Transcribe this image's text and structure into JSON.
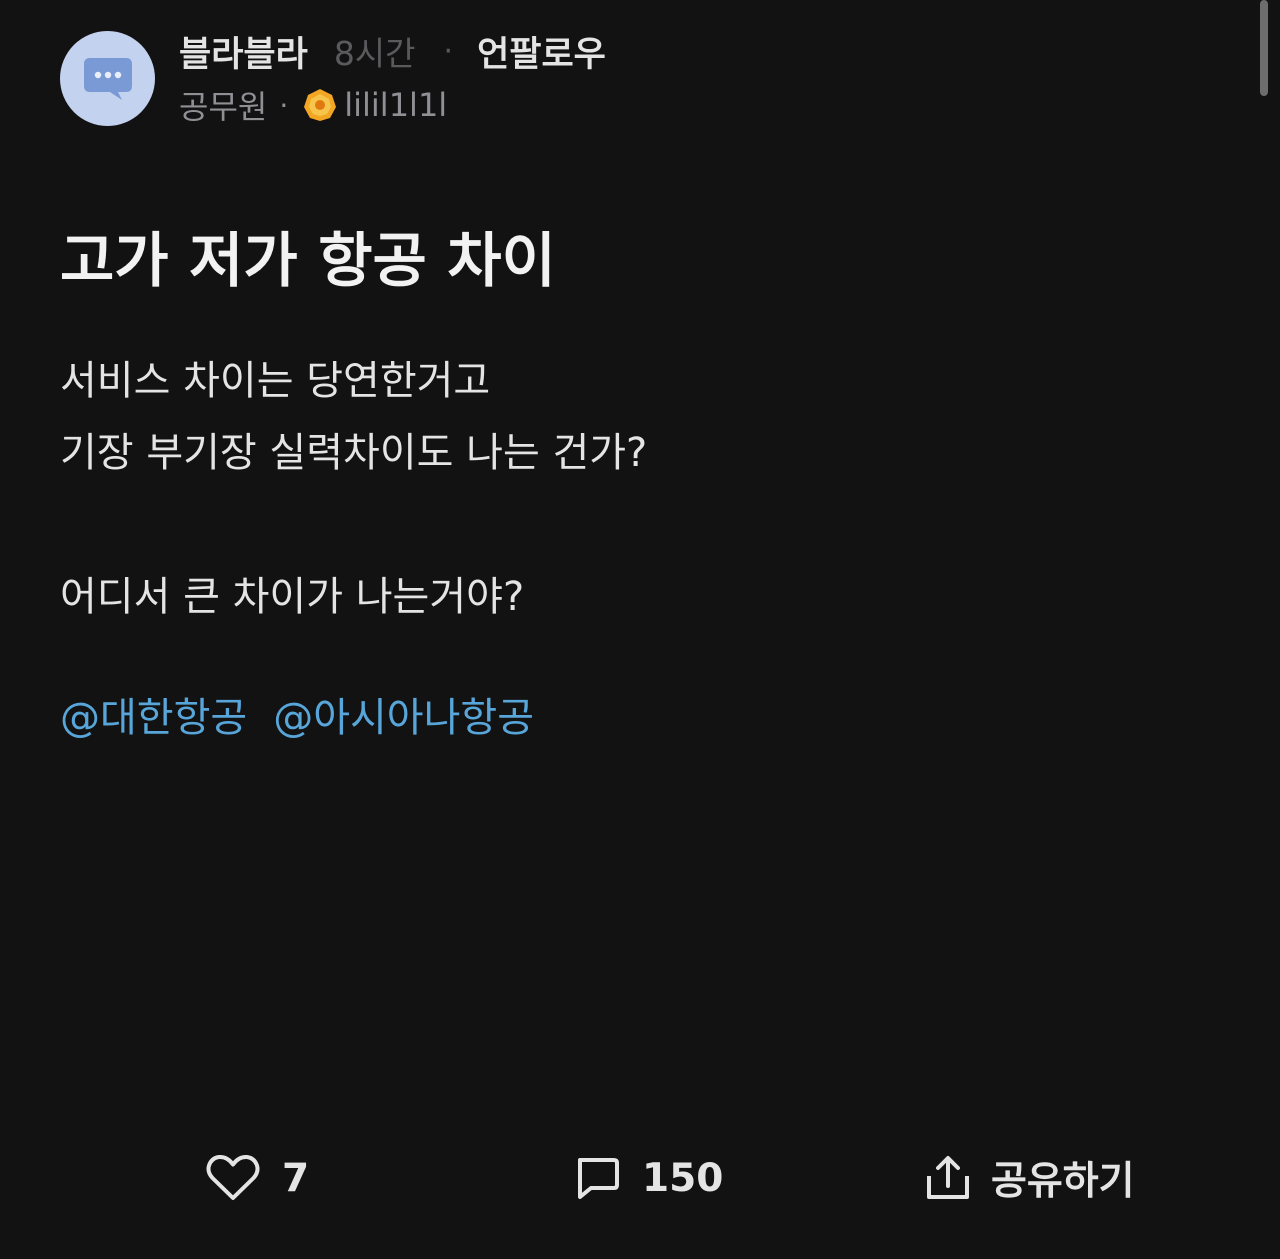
{
  "author": {
    "name": "블라블라",
    "time": "8시간",
    "separator": "·",
    "unfollow_label": "언팔로우",
    "job": "공무원",
    "job_separator": "·",
    "handle": "lilil1l1l"
  },
  "post": {
    "title": "고가 저가 항공 차이",
    "body_lines": [
      "서비스 차이는 당연한거고",
      "기장 부기장 실력차이도 나는 건가?",
      "",
      "어디서 큰 차이가 나는거야?"
    ],
    "mentions": [
      "@대한항공",
      "@아시아나항공"
    ]
  },
  "actions": {
    "like_count": "7",
    "comment_count": "150",
    "share_label": "공유하기"
  },
  "colors": {
    "background": "#121213",
    "mention": "#58a6d9",
    "avatar_bg": "#c3d2ef",
    "avatar_bubble": "#7a9ad6",
    "badge": "#f2a623"
  },
  "icons": {
    "avatar": "chat-bubble-icon",
    "badge": "gold-badge-icon",
    "like": "heart-outline-icon",
    "comment": "comment-bubble-icon",
    "share": "share-upload-icon"
  }
}
